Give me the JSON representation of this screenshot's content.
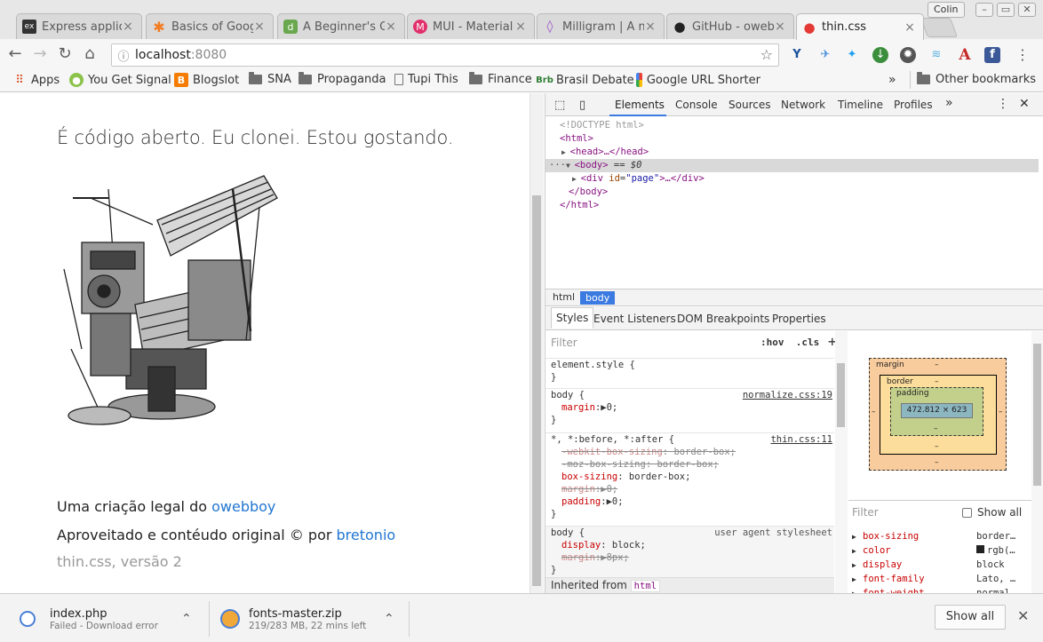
{
  "window": {
    "profile": "Colin",
    "tabs": [
      {
        "label": "Express applic",
        "favicon": "ex"
      },
      {
        "label": "Basics of Goog",
        "favicon": "✱"
      },
      {
        "label": "A Beginner's G",
        "favicon": "d"
      },
      {
        "label": "MUI - Material",
        "favicon": "M"
      },
      {
        "label": "Milligram | A m",
        "favicon": "◊"
      },
      {
        "label": "GitHub - oweb",
        "favicon": "●"
      },
      {
        "label": "thin.css",
        "favicon": "●"
      }
    ]
  },
  "omnibox": {
    "host": "localhost",
    "port": ":8080"
  },
  "bookmarks": {
    "items": [
      {
        "label": "Apps",
        "icon": "apps-grid-icon"
      },
      {
        "label": "You Get Signal",
        "icon": "globe-icon"
      },
      {
        "label": "Blogslot",
        "icon": "blogger-icon"
      },
      {
        "label": "SNA",
        "icon": "folder-icon"
      },
      {
        "label": "Propaganda",
        "icon": "folder-icon"
      },
      {
        "label": "Tupi This",
        "icon": "page-icon"
      },
      {
        "label": "Finance",
        "icon": "folder-icon"
      },
      {
        "label": "Brasil Debate",
        "icon": "brasil-debate-icon"
      },
      {
        "label": "Google URL Shorter",
        "icon": "google-icon"
      }
    ],
    "overflow": "»",
    "other": "Other bookmarks"
  },
  "page": {
    "headline": "É código aberto. Eu clonei. Estou gostando.",
    "credit_prefix": "Uma criação legal do ",
    "credit_link": "owebboy",
    "adapted_prefix": "Aproveitado e contéudo original © por ",
    "adapted_link": "bretonio",
    "version": "thin.css, versão 2"
  },
  "devtools": {
    "tabs": [
      "Elements",
      "Console",
      "Sources",
      "Network",
      "Timeline",
      "Profiles"
    ],
    "more": "»",
    "dom": {
      "doctype": "<!DOCTYPE html>",
      "html_open": "<html>",
      "head": "<head>…</head>",
      "body_open": "<body>",
      "body_marker": " == $0",
      "div_tag": "div",
      "div_attr": "id",
      "div_val": "\"page\"",
      "body_close": "</body>",
      "html_close": "</html>"
    },
    "breadcrumbs": [
      "html",
      "body"
    ],
    "subtabs": [
      "Styles",
      "Event Listeners",
      "DOM Breakpoints",
      "Properties"
    ],
    "styles": {
      "filter_placeholder": "Filter",
      "hov": ":hov",
      "cls": ".cls",
      "element_style": "element.style {",
      "close": "}",
      "rule1_selector": "body {",
      "rule1_source": "normalize.css:19",
      "rule1_prop": "margin",
      "rule1_val": "▶0;",
      "rule2_selector": "*, *:before, *:after {",
      "rule2_source": "thin.css:11",
      "rule2_l1_prop": "-webkit-box-sizing",
      "rule2_l1_val": " border-box;",
      "rule2_l2": "-moz-box-sizing: border-box;",
      "rule2_l3_prop": "box-sizing",
      "rule2_l3_val": " border-box;",
      "rule2_l4_prop": "margin",
      "rule2_l4_val": "▶0;",
      "rule2_l5_prop": "padding",
      "rule2_l5_val": "▶0;",
      "rule3_selector": "body {",
      "rule3_source": "user agent stylesheet",
      "rule3_l1_prop": "display",
      "rule3_l1_val": " block;",
      "rule3_l2_prop": "margin",
      "rule3_l2_val": "▶8px;",
      "inherited_label": "Inherited from ",
      "inherited_tag": "html"
    },
    "boxmodel": {
      "margin": "margin",
      "border": "border",
      "padding": "padding",
      "dash": "–",
      "content": "472.812 × 623"
    },
    "computed": {
      "filter_placeholder": "Filter",
      "show_all": "Show all",
      "props": [
        {
          "name": "box-sizing",
          "value": "border…"
        },
        {
          "name": "color",
          "value": "rgb(…"
        },
        {
          "name": "display",
          "value": "block"
        },
        {
          "name": "font-family",
          "value": "Lato, …"
        },
        {
          "name": "font-weight",
          "value": "normal"
        }
      ]
    }
  },
  "downloads": {
    "items": [
      {
        "name": "index.php",
        "status": "Failed - Download error"
      },
      {
        "name": "fonts-master.zip",
        "status": "219/283 MB, 22 mins left"
      }
    ],
    "show_all": "Show all",
    "close": "✕"
  },
  "colors": {
    "link": "#2276d2",
    "accent": "#3b7ae0"
  }
}
